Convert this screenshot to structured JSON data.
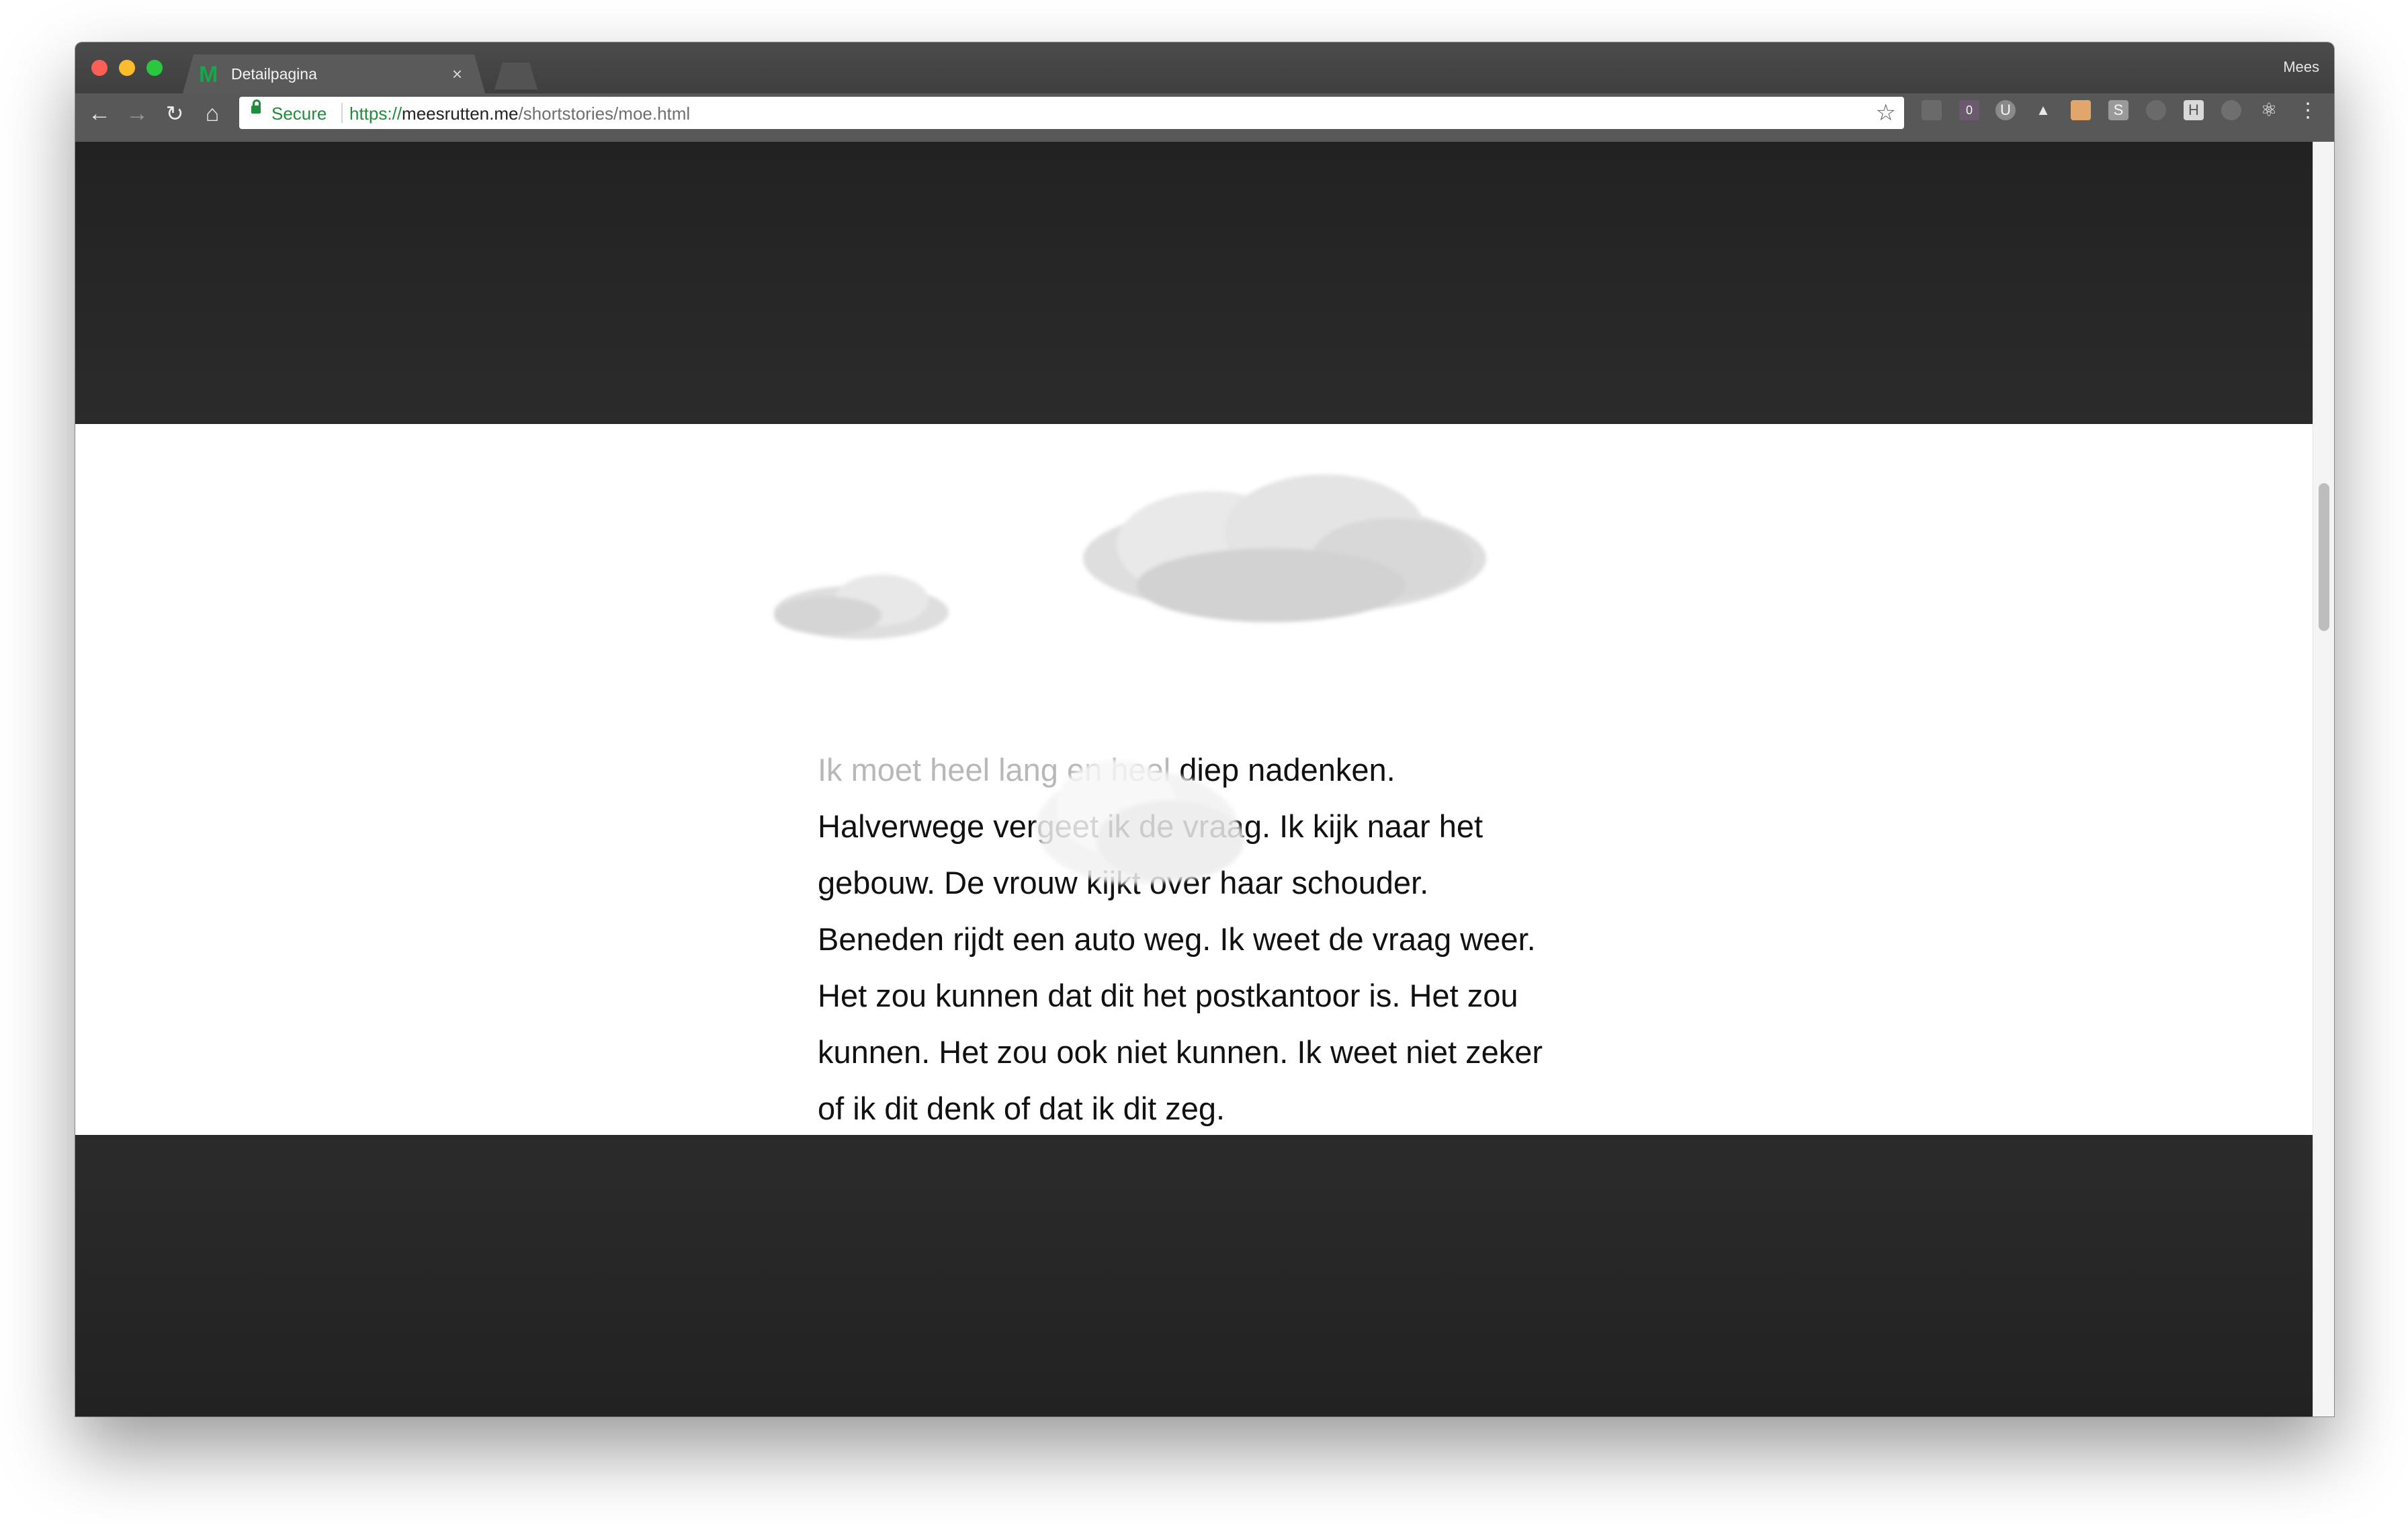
{
  "browser": {
    "tab_title": "Detailpagina",
    "tab_favicon": "M",
    "tab_close": "×",
    "profile_name": "Mees",
    "address": {
      "secure_label": "Secure",
      "url_scheme": "https://",
      "url_host": "meesrutten.me",
      "url_path": "/shortstories/moe.html"
    },
    "extensions": [
      {
        "icon": "cast-icon",
        "label": ""
      },
      {
        "icon": "badge-extension-icon",
        "label": "0"
      },
      {
        "icon": "ublock-icon",
        "label": "U"
      },
      {
        "icon": "google-drive-icon",
        "label": "▲"
      },
      {
        "icon": "face-extension-icon",
        "label": ""
      },
      {
        "icon": "s-extension-icon",
        "label": "S"
      },
      {
        "icon": "disabled-extension-icon",
        "label": ""
      },
      {
        "icon": "h-extension-icon",
        "label": "H"
      },
      {
        "icon": "record-extension-icon",
        "label": ""
      },
      {
        "icon": "react-devtools-icon",
        "label": "⚛"
      }
    ]
  },
  "story": {
    "faded_line_start": "Ik moet heel lang en heel",
    "lines": [
      " diep nadenken.",
      "Halverwege vergeet ik de vraag. Ik kijk naar het",
      "gebouw. De vrouw kijkt over haar schouder.",
      "Beneden rijdt een auto weg. Ik weet de vraag weer.",
      "Het zou kunnen dat dit het postkantoor is. Het zou",
      "kunnen. Het zou ook niet kunnen. Ik weet niet zeker",
      "of ik dit denk of dat ik dit zeg."
    ]
  },
  "colors": {
    "dark_band": "#262626",
    "text": "#111111",
    "faded_text": "#b8b8b8",
    "secure_green": "#1e8c3a"
  }
}
